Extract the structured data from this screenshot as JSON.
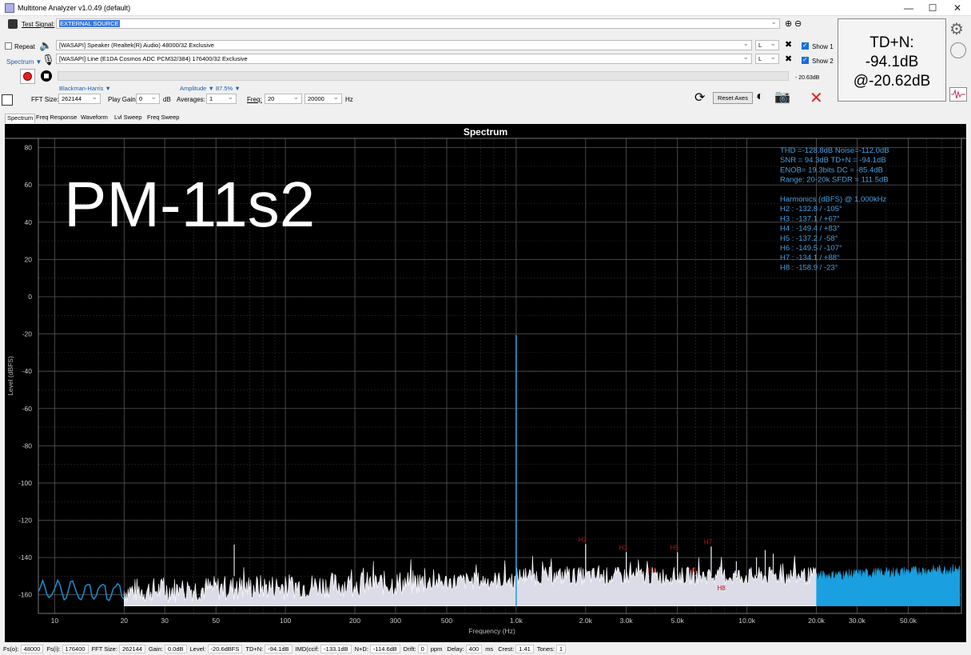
{
  "window": {
    "title": "Multitone Analyzer v1.0.49 (default)",
    "minimize_icon": "minimize-icon",
    "maximize_icon": "maximize-icon",
    "close_icon": "close-icon"
  },
  "toolbar": {
    "test_signal_label": "Test Signal:",
    "test_signal_value": "EXTERNAL SOURCE",
    "repeat_label": "Repeat",
    "spectrum_label": "Spectrum",
    "output_device": "[WASAPI] Speaker (Realtek(R) Audio) 48000/32 Exclusive",
    "input_device": "[WASAPI] Line (E1DA Cosmos ADC PCM32/384) 176400/32 Exclusive",
    "output_channel": "L",
    "input_channel": "L",
    "show1_label": "Show 1",
    "show2_label": "Show 2",
    "level_readout": "- 20.63dB",
    "window_function": "Blackman-Harris",
    "amplitude_label": "Amplitude",
    "amplitude_value": "87.5%",
    "fft_size_label": "FFT Size:",
    "fft_size": "262144",
    "play_gain_label": "Play Gain:",
    "play_gain": "0",
    "play_gain_unit": "dB",
    "averages_label": "Averages:",
    "averages": "1",
    "freq_label": "Freq:",
    "freq_min": "20",
    "freq_max": "20000",
    "freq_unit": "Hz",
    "reset_axes_label": "Reset Axes"
  },
  "tdn_display": {
    "line1": "TD+N:",
    "line2": "-94.1dB",
    "line3": "@-20.62dB"
  },
  "tabs": [
    "Spectrum",
    "Freq Response",
    "Waveform",
    "Lvl Sweep",
    "Freq Sweep"
  ],
  "overlay_label": "PM-11s2",
  "chart_data": {
    "type": "line",
    "title": "Spectrum",
    "xlabel": "Frequency (Hz)",
    "ylabel": "Level (dBFS)",
    "x_scale": "log",
    "xlim": [
      8.5,
      85000
    ],
    "ylim": [
      -170,
      85
    ],
    "grid": true,
    "x_ticks": [
      {
        "v": 10,
        "l": "10"
      },
      {
        "v": 20,
        "l": "20"
      },
      {
        "v": 30,
        "l": "30"
      },
      {
        "v": 50,
        "l": "50"
      },
      {
        "v": 100,
        "l": "100"
      },
      {
        "v": 200,
        "l": "200"
      },
      {
        "v": 300,
        "l": "300"
      },
      {
        "v": 500,
        "l": "500"
      },
      {
        "v": 1000,
        "l": "1.0k"
      },
      {
        "v": 2000,
        "l": "2.0k"
      },
      {
        "v": 3000,
        "l": "3.0k"
      },
      {
        "v": 5000,
        "l": "5.0k"
      },
      {
        "v": 10000,
        "l": "10.0k"
      },
      {
        "v": 20000,
        "l": "20.0k"
      },
      {
        "v": 30000,
        "l": "30.0k"
      },
      {
        "v": 50000,
        "l": "50.0k"
      }
    ],
    "y_ticks": [
      80,
      60,
      40,
      20,
      0,
      -20,
      -40,
      -60,
      -80,
      -100,
      -120,
      -140,
      -160
    ],
    "fundamental": {
      "freq": 1000,
      "level": -20.6
    },
    "harmonics": [
      {
        "name": "H2",
        "freq": 2000,
        "level": -132.8
      },
      {
        "name": "H3",
        "freq": 3000,
        "level": -137.1
      },
      {
        "name": "H4",
        "freq": 4000,
        "level": -149.4
      },
      {
        "name": "H5",
        "freq": 5000,
        "level": -137.2
      },
      {
        "name": "H6",
        "freq": 6000,
        "level": -149.5
      },
      {
        "name": "H7",
        "freq": 7000,
        "level": -134.1
      },
      {
        "name": "H8",
        "freq": 8000,
        "level": -158.9
      }
    ],
    "spurs": [
      {
        "freq": 60,
        "level": -133
      },
      {
        "freq": 11000,
        "level": -140
      },
      {
        "freq": 12000,
        "level": -136
      },
      {
        "freq": 13000,
        "level": -138
      },
      {
        "freq": 9000,
        "level": -142
      }
    ],
    "noise_floor": {
      "low_band": -158,
      "mid_band": -150,
      "high_band": -150
    },
    "stats_block": [
      "THD =-128.8dB     Noise=-112.0dB",
      "SNR =  94.3dB     TD+N = -94.1dB",
      "ENOB= 19.3bits    DC   = -85.4dB",
      "Range: 20-20k     SFDR = 111.5dB",
      "",
      "Harmonics (dBFS) @ 1.000kHz",
      "H2 :  -132.8 / -105°",
      "H3 :  -137.1 /  +67°",
      "H4 :  -149.4 /  +83°",
      "H5 :  -137.2 /  -58°",
      "H6 :  -149.5 / -107°",
      "H7 :  -134.1 /  +88°",
      "H8 :  -158.9 /  -23°"
    ],
    "colors": {
      "low_band": "#1a8fd0",
      "main_band": "#dcdce8",
      "high_band": "#1aa0e0",
      "harmonic_label": "#c01010",
      "stats": "#4aa0e0"
    }
  },
  "status_bar": [
    {
      "label": "Fs(o):",
      "value": "48000"
    },
    {
      "label": "Fs(i):",
      "value": "176400"
    },
    {
      "label": "FFT Size:",
      "value": "262144"
    },
    {
      "label": "Gain:",
      "value": "0.0dB"
    },
    {
      "label": "Level:",
      "value": "-20.6dBFS"
    },
    {
      "label": "TD+N:",
      "value": "-94.1dB"
    },
    {
      "label": "IMD(ccif:",
      "value": "-133.1dB"
    },
    {
      "label": "N+D:",
      "value": "-114.6dB"
    },
    {
      "label": "Drift:",
      "value": "0",
      "unit": "ppm"
    },
    {
      "label": "Delay:",
      "value": "400",
      "unit": "ms"
    },
    {
      "label": "Crest:",
      "value": "1.41"
    },
    {
      "label": "Tones:",
      "value": "1"
    }
  ]
}
